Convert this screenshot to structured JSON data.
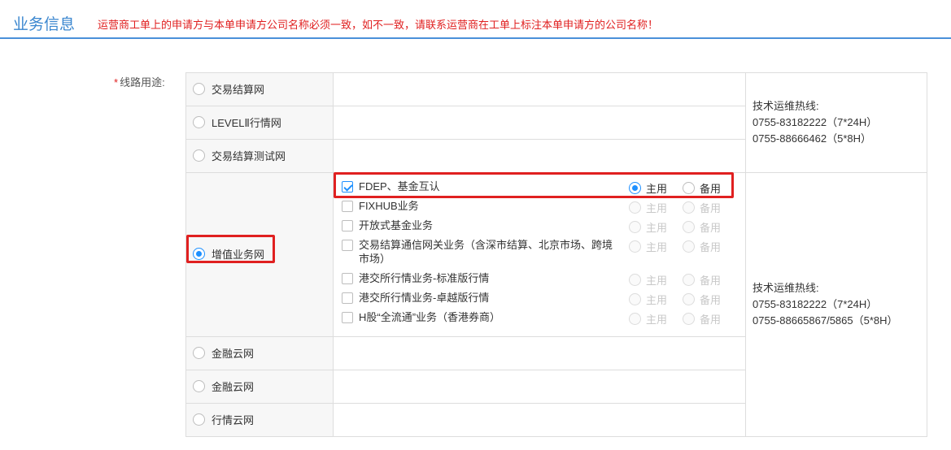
{
  "header": {
    "title": "业务信息",
    "notice": "运营商工单上的申请方与本单申请方公司名称必须一致，如不一致，请联系运营商在工单上标注本单申请方的公司名称！"
  },
  "field": {
    "required_mark": "*",
    "label": "线路用途:"
  },
  "options_top": [
    {
      "label": "交易结算网",
      "selected": false
    },
    {
      "label": "LEVELⅡ行情网",
      "selected": false
    },
    {
      "label": "交易结算测试网",
      "selected": false
    }
  ],
  "hotline_1": {
    "title": "技术运维热线:",
    "line1": "0755-83182222（7*24H）",
    "line2": "0755-88666462（5*8H）"
  },
  "value_added": {
    "label": "增值业务网",
    "selected": true,
    "primary_label": "主用",
    "backup_label": "备用",
    "services": [
      {
        "label": "FDEP、基金互认",
        "checked": true,
        "mode": "主用",
        "enabled": true
      },
      {
        "label": "FIXHUB业务",
        "checked": false,
        "enabled": false
      },
      {
        "label": "开放式基金业务",
        "checked": false,
        "enabled": false
      },
      {
        "label": "交易结算通信网关业务（含深市结算、北京市场、跨境市场）",
        "checked": false,
        "enabled": false
      },
      {
        "label": "港交所行情业务-标准版行情",
        "checked": false,
        "enabled": false
      },
      {
        "label": "港交所行情业务-卓越版行情",
        "checked": false,
        "enabled": false
      },
      {
        "label": "H股“全流通”业务（香港券商）",
        "checked": false,
        "enabled": false
      }
    ]
  },
  "hotline_2": {
    "title": "技术运维热线:",
    "line1": "0755-83182222（7*24H）",
    "line2": "0755-88665867/5865（5*8H）"
  },
  "options_bottom": [
    {
      "label": "金融云网",
      "selected": false
    },
    {
      "label": "金融云网",
      "selected": false
    },
    {
      "label": "行情云网",
      "selected": false
    }
  ],
  "colors": {
    "accent": "#1e90ff",
    "title_blue": "#3a86cf",
    "alert_red": "#e02020",
    "border": "#dddddd"
  }
}
